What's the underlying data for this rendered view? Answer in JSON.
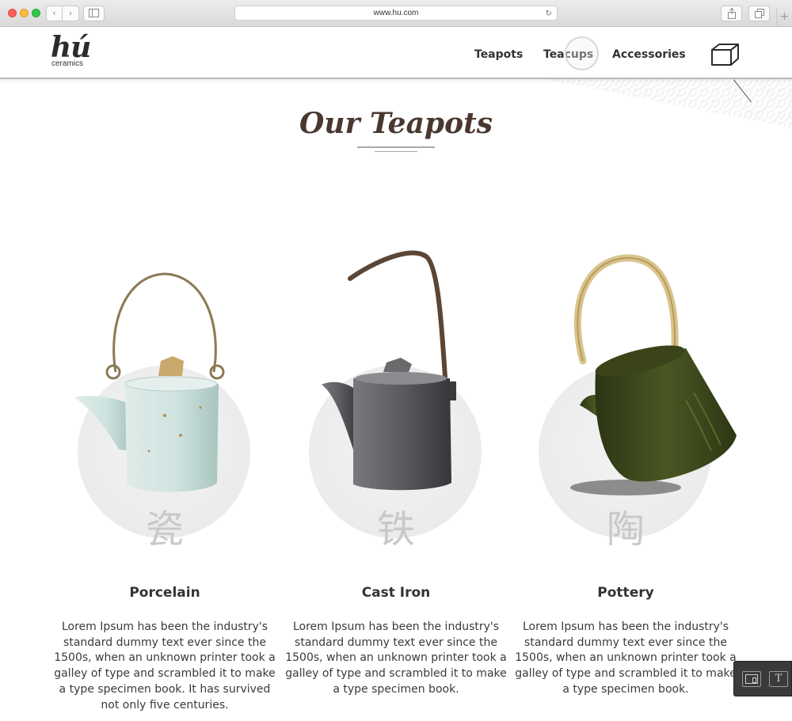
{
  "browser": {
    "url": "www.hu.com"
  },
  "logo": {
    "mark": "hú",
    "subtitle": "ceramics"
  },
  "nav": {
    "items": [
      {
        "label": "Teapots"
      },
      {
        "label": "Teacups"
      },
      {
        "label": "Accessories"
      }
    ],
    "cart_icon": "box-icon"
  },
  "page": {
    "title": "Our Teapots"
  },
  "products": [
    {
      "name": "Porcelain",
      "hanzi": "瓷",
      "description": "Lorem Ipsum has been the industry's standard dummy text ever since the 1500s, when an unknown printer took a galley of type and scrambled it to make a type specimen book. It has survived not only five centuries."
    },
    {
      "name": "Cast Iron",
      "hanzi": "铁",
      "description": "Lorem Ipsum has been the industry's standard dummy text ever since the 1500s, when an unknown printer took a galley of type and scrambled it to make a type specimen book."
    },
    {
      "name": "Pottery",
      "hanzi": "陶",
      "description": "Lorem Ipsum has been the industry's standard dummy text ever since the 1500s, when an unknown printer took a galley of type and scrambled it to make a type specimen book."
    }
  ],
  "tool_panel": {
    "device_icon": "device-preview-icon",
    "text_label": "T"
  },
  "colors": {
    "title": "#4a3830",
    "text": "#333333",
    "hanzi": "#c9c9c9",
    "circle": "#ececec",
    "porcelain": "#cfe3df",
    "cast_iron": "#5a5b5e",
    "pottery": "#3f4a1c"
  }
}
